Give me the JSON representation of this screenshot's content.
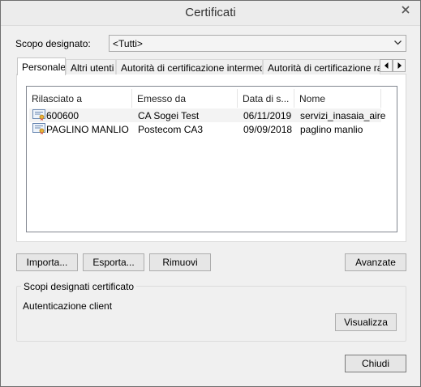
{
  "window": {
    "title": "Certificati"
  },
  "scope": {
    "label": "Scopo designato:",
    "selected": "<Tutti>"
  },
  "tabs": [
    {
      "label": "Personale",
      "active": true
    },
    {
      "label": "Altri utenti",
      "active": false
    },
    {
      "label": "Autorità di certificazione intermedie",
      "active": false
    },
    {
      "label": "Autorità di certificazione radice attendibili",
      "active": false
    }
  ],
  "table": {
    "columns": [
      "Rilasciato a",
      "Emesso da",
      "Data di s...",
      "Nome"
    ],
    "rows": [
      {
        "issued_to": "600600",
        "issued_by": "CA Sogei Test",
        "date": "06/11/2019",
        "name": "servizi_inasaia_aire"
      },
      {
        "issued_to": "PAGLINO MANLIO",
        "issued_by": "Postecom CA3",
        "date": "09/09/2018",
        "name": "paglino manlio"
      }
    ]
  },
  "buttons": {
    "import": "Importa...",
    "export": "Esporta...",
    "remove": "Rimuovi",
    "advanced": "Avanzate",
    "view": "Visualizza",
    "close": "Chiudi"
  },
  "purposes": {
    "legend": "Scopi designati certificato",
    "value": "Autenticazione client"
  },
  "icons": {
    "close": "close-icon",
    "dropdown": "chevron-down-icon",
    "tab_left": "arrow-left-icon",
    "tab_right": "arrow-right-icon",
    "certificate": "certificate-icon"
  }
}
